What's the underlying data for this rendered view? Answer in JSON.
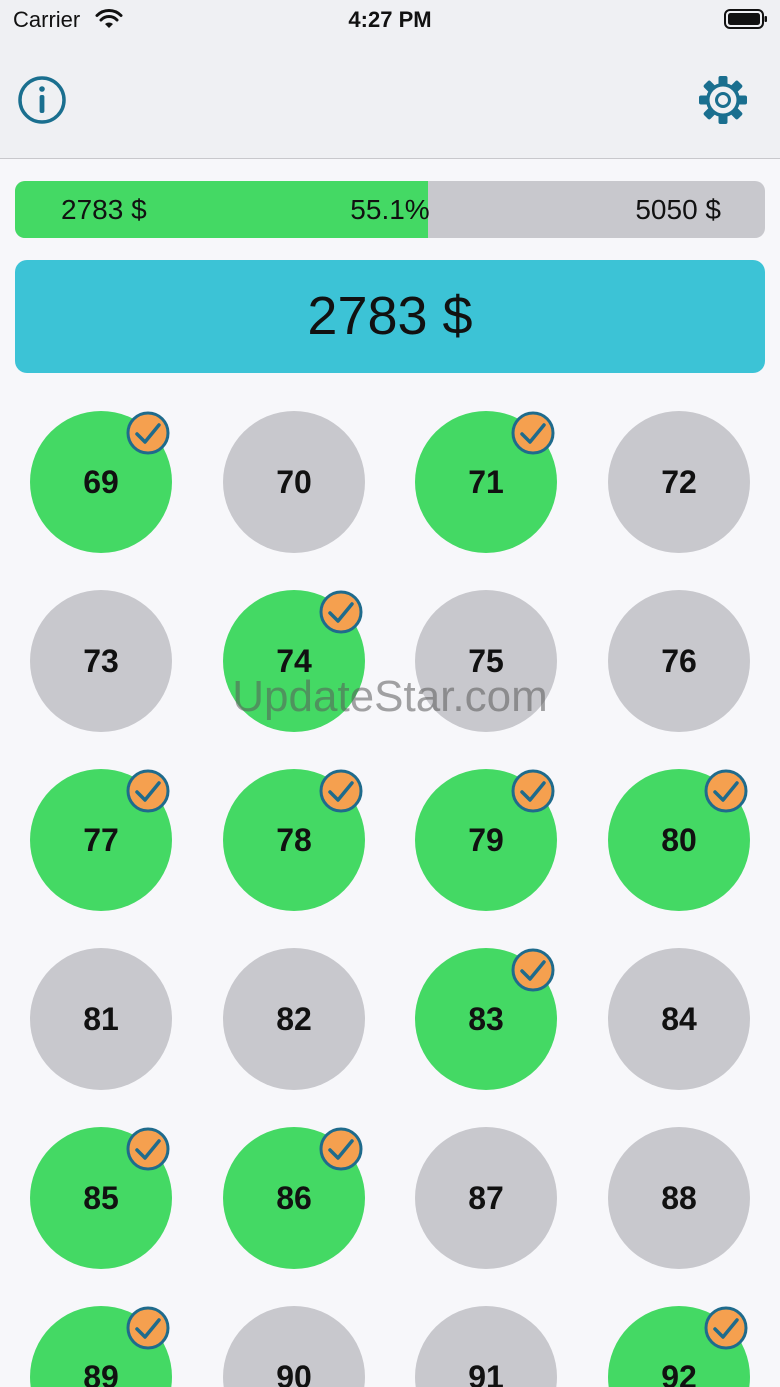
{
  "status_bar": {
    "carrier": "Carrier",
    "time": "4:27 PM"
  },
  "nav": {
    "info_icon": "info-circle-icon",
    "settings_icon": "gear-icon"
  },
  "progress": {
    "current_label": "2783 $",
    "percent_label": "55.1%",
    "goal_label": "5050 $",
    "fraction": 0.551
  },
  "total": {
    "label": "2783 $"
  },
  "cells": [
    {
      "number": "69",
      "done": true
    },
    {
      "number": "70",
      "done": false
    },
    {
      "number": "71",
      "done": true
    },
    {
      "number": "72",
      "done": false
    },
    {
      "number": "73",
      "done": false
    },
    {
      "number": "74",
      "done": true
    },
    {
      "number": "75",
      "done": false
    },
    {
      "number": "76",
      "done": false
    },
    {
      "number": "77",
      "done": true
    },
    {
      "number": "78",
      "done": true
    },
    {
      "number": "79",
      "done": true
    },
    {
      "number": "80",
      "done": true
    },
    {
      "number": "81",
      "done": false
    },
    {
      "number": "82",
      "done": false
    },
    {
      "number": "83",
      "done": true
    },
    {
      "number": "84",
      "done": false
    },
    {
      "number": "85",
      "done": true
    },
    {
      "number": "86",
      "done": true
    },
    {
      "number": "87",
      "done": false
    },
    {
      "number": "88",
      "done": false
    },
    {
      "number": "89",
      "done": true
    },
    {
      "number": "90",
      "done": false
    },
    {
      "number": "91",
      "done": false
    },
    {
      "number": "92",
      "done": true
    }
  ],
  "colors": {
    "done": "#44d964",
    "pending": "#c8c8cd",
    "badge": "#f5a04f",
    "badge_ring": "#1f6b8c",
    "accent": "#1a6f8f",
    "total_bg": "#3cc3d6"
  },
  "watermark": "UpdateStar.com"
}
